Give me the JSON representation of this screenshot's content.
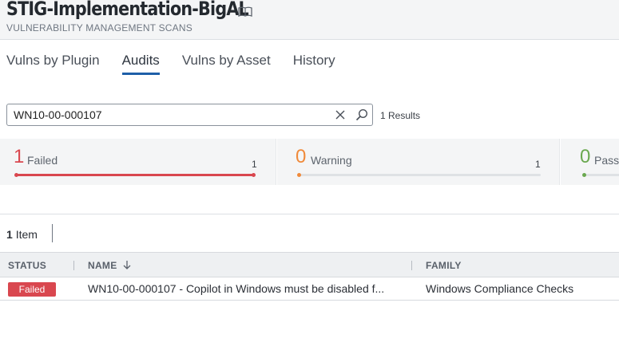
{
  "header": {
    "title": "STIG-Implementation-BigAL",
    "subtitle": "VULNERABILITY MANAGEMENT SCANS",
    "title_icon": "book-icon"
  },
  "tabs": [
    {
      "label": "Vulns by Plugin",
      "active": false
    },
    {
      "label": "Audits",
      "active": true
    },
    {
      "label": "Vulns by Asset",
      "active": false
    },
    {
      "label": "History",
      "active": false
    }
  ],
  "search": {
    "value": "WN10-00-000107",
    "clear_icon": "close-icon",
    "search_icon": "search-icon",
    "results_text": "1 Results"
  },
  "summary": [
    {
      "count": "1",
      "label": "Failed",
      "total": "1",
      "color": "#d9474f",
      "level": 1.0
    },
    {
      "count": "0",
      "label": "Warning",
      "total": "1",
      "color": "#f08a3a",
      "level": 0
    },
    {
      "count": "0",
      "label": "Passe",
      "total": "",
      "color": "#6aa84f",
      "level": 0
    }
  ],
  "items": {
    "count": "1",
    "label": "Item"
  },
  "table": {
    "columns": {
      "status": "STATUS",
      "name": "NAME",
      "family": "FAMILY"
    },
    "sort_icon": "arrow-down-icon",
    "rows": [
      {
        "status": "Failed",
        "name": "WN10-00-000107 - Copilot in Windows must be disabled f...",
        "family": "Windows Compliance Checks"
      }
    ]
  },
  "colors": {
    "accent": "#1e5fa8",
    "failed": "#d9474f",
    "warning": "#f08a3a",
    "passed": "#6aa84f"
  }
}
